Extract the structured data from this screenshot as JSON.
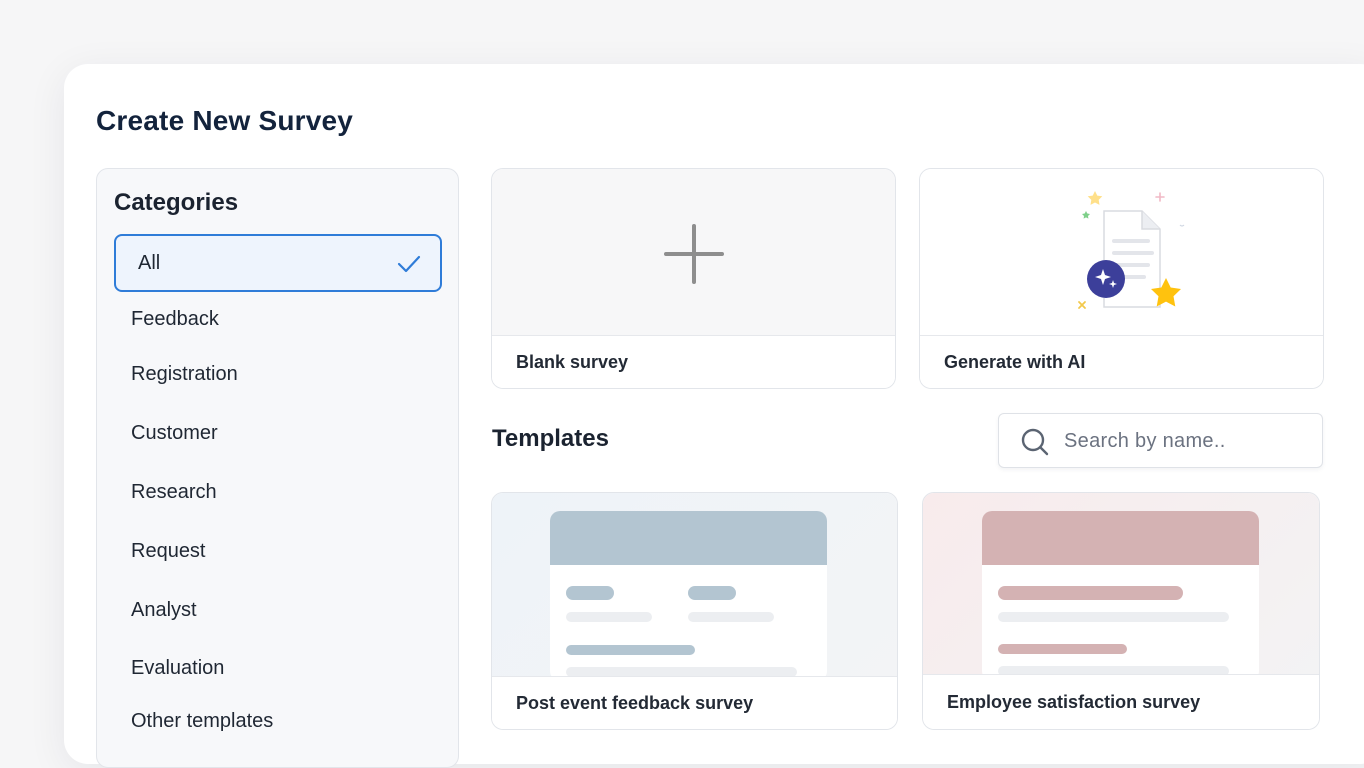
{
  "page": {
    "title": "Create New Survey"
  },
  "categories": {
    "title": "Categories",
    "items": [
      {
        "label": "All",
        "selected": true
      },
      {
        "label": "Feedback"
      },
      {
        "label": "Registration"
      },
      {
        "label": "Customer"
      },
      {
        "label": "Research"
      },
      {
        "label": "Request"
      },
      {
        "label": "Analyst"
      },
      {
        "label": "Evaluation"
      },
      {
        "label": "Other templates"
      }
    ]
  },
  "start_options": {
    "blank": {
      "label": "Blank survey",
      "icon": "plus-icon"
    },
    "ai": {
      "label": "Generate with AI",
      "icon": "ai-document-illustration"
    }
  },
  "templates": {
    "title": "Templates",
    "search_placeholder": "Search by name..",
    "items": [
      {
        "label": "Post event feedback survey",
        "accent": "#b3c5d1"
      },
      {
        "label": "Employee satisfaction survey",
        "accent": "#d4b2b3"
      }
    ]
  },
  "colors": {
    "selection_border": "#2f7cd8",
    "selection_bg": "#eef4fd",
    "title_text": "#13233c",
    "star_yellow": "#ffc20e",
    "ai_badge": "#3c3f9a"
  }
}
